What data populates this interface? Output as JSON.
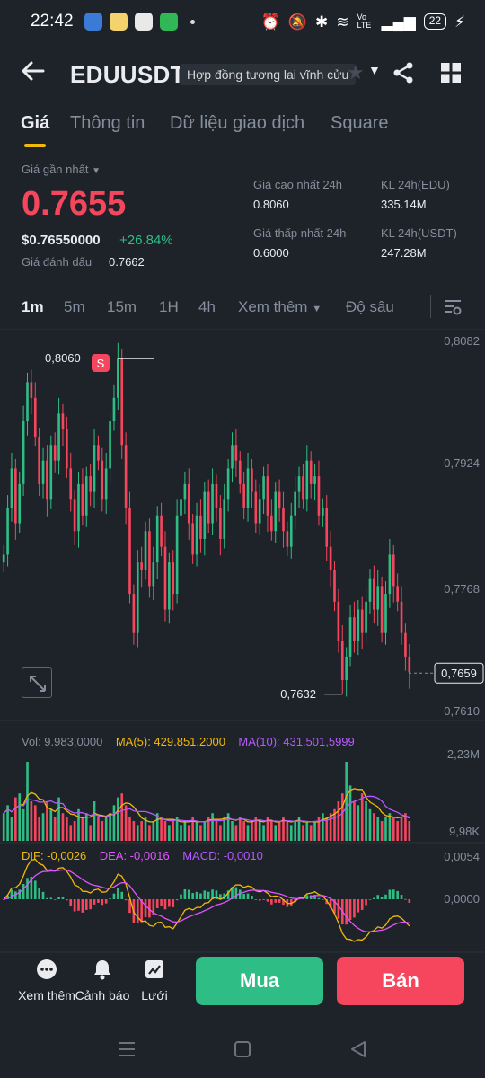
{
  "status_bar": {
    "time": "22:42",
    "battery": "22",
    "net": "Vo LTE",
    "icons": [
      "alarm-icon",
      "mute-icon",
      "bluetooth-icon",
      "wifi-icon",
      "signal-icon",
      "charging-icon"
    ]
  },
  "header": {
    "pair": "EDUUSDT",
    "contract_type": "Hợp đồng tương lai vĩnh cửu",
    "icons": [
      "back-arrow-icon",
      "star-icon",
      "share-icon",
      "grid-icon"
    ]
  },
  "tabs": [
    {
      "label": "Giá",
      "active": true
    },
    {
      "label": "Thông tin",
      "active": false
    },
    {
      "label": "Dữ liệu giao dịch",
      "active": false
    },
    {
      "label": "Square",
      "active": false
    }
  ],
  "ticker": {
    "last_price_label": "Giá gần nhất",
    "last_price": "0.7655",
    "usd_price": "$0.76550000",
    "change": "+26.84%",
    "mark_price_label": "Giá đánh dấu",
    "mark_price": "0.7662",
    "high_label": "Giá cao nhất 24h",
    "high": "0.8060",
    "low_label": "Giá thấp nhất 24h",
    "low": "0.6000",
    "vol_base_label": "KL 24h(EDU)",
    "vol_base": "335.14M",
    "vol_quote_label": "KL 24h(USDT)",
    "vol_quote": "247.28M"
  },
  "intervals": {
    "items": [
      {
        "label": "1m",
        "active": true
      },
      {
        "label": "5m",
        "active": false
      },
      {
        "label": "15m",
        "active": false
      },
      {
        "label": "1H",
        "active": false
      },
      {
        "label": "4h",
        "active": false
      }
    ],
    "more": "Xem thêm",
    "depth": "Độ sâu"
  },
  "chart_data": {
    "type": "candlestick",
    "price_axis_labels": [
      "0,8082",
      "0,7924",
      "0,7768",
      "0,7610"
    ],
    "price_axis_values": [
      0.8082,
      0.7924,
      0.7768,
      0.761
    ],
    "max_marker": "0,8060",
    "min_marker": "0,7632",
    "current_price": "0,7659",
    "current_price_value": 0.7659,
    "signal_badge": "S",
    "close_series": [
      0.781,
      0.787,
      0.792,
      0.785,
      0.79,
      0.798,
      0.803,
      0.801,
      0.796,
      0.79,
      0.793,
      0.788,
      0.795,
      0.793,
      0.799,
      0.797,
      0.792,
      0.788,
      0.784,
      0.79,
      0.786,
      0.791,
      0.789,
      0.795,
      0.793,
      0.788,
      0.792,
      0.798,
      0.801,
      0.806,
      0.795,
      0.787,
      0.776,
      0.771,
      0.78,
      0.779,
      0.784,
      0.777,
      0.78,
      0.786,
      0.782,
      0.774,
      0.78,
      0.776,
      0.786,
      0.788,
      0.79,
      0.785,
      0.781,
      0.786,
      0.783,
      0.789,
      0.785,
      0.79,
      0.787,
      0.783,
      0.788,
      0.792,
      0.795,
      0.793,
      0.79,
      0.787,
      0.792,
      0.789,
      0.785,
      0.788,
      0.791,
      0.786,
      0.784,
      0.789,
      0.787,
      0.784,
      0.782,
      0.786,
      0.789,
      0.791,
      0.788,
      0.793,
      0.79,
      0.791,
      0.786,
      0.787,
      0.782,
      0.779,
      0.775,
      0.77,
      0.765,
      0.768,
      0.773,
      0.77,
      0.774,
      0.771,
      0.775,
      0.778,
      0.774,
      0.777,
      0.771,
      0.776,
      0.781,
      0.777,
      0.775,
      0.771,
      0.768,
      0.766
    ],
    "volume": {
      "vol_label": "Vol: 9.983,0000",
      "ma5_label": "MA(5): 429.851,2000",
      "ma10_label": "MA(10): 431.501,5999",
      "axis_top": "2,23M",
      "axis_bottom": "9,98K",
      "values": [
        0.35,
        0.45,
        0.3,
        0.55,
        0.6,
        0.4,
        1.0,
        0.5,
        0.45,
        0.3,
        0.35,
        0.5,
        0.4,
        0.3,
        0.55,
        0.35,
        0.3,
        0.2,
        0.25,
        0.4,
        0.3,
        0.35,
        0.2,
        0.5,
        0.3,
        0.25,
        0.3,
        0.35,
        0.45,
        0.55,
        0.6,
        0.45,
        0.3,
        0.25,
        0.2,
        0.25,
        0.3,
        0.2,
        0.25,
        0.35,
        0.3,
        0.25,
        0.2,
        0.25,
        0.3,
        0.2,
        0.25,
        0.2,
        0.3,
        0.25,
        0.2,
        0.25,
        0.3,
        0.35,
        0.25,
        0.2,
        0.3,
        0.35,
        0.25,
        0.2,
        0.3,
        0.25,
        0.2,
        0.25,
        0.3,
        0.25,
        0.2,
        0.3,
        0.25,
        0.2,
        0.25,
        0.3,
        0.25,
        0.2,
        0.25,
        0.3,
        0.2,
        0.25,
        0.2,
        0.25,
        0.3,
        0.35,
        0.3,
        0.35,
        0.4,
        0.5,
        0.6,
        1.0,
        0.7,
        0.5,
        0.45,
        0.6,
        0.5,
        0.4,
        0.35,
        0.3,
        0.25,
        0.3,
        0.35,
        0.3,
        0.25,
        0.3,
        0.35,
        0.25
      ]
    },
    "macd": {
      "dif_label": "DIF: -0,0026",
      "dea_label": "DEA: -0,0016",
      "macd_label": "MACD: -0,0010",
      "axis_top": "0,0054",
      "axis_mid": "0,0000"
    }
  },
  "bottom_bar": {
    "more": "Xem thêm",
    "alert": "Cảnh báo",
    "grid": "Lưới",
    "buy": "Mua",
    "sell": "Bán"
  },
  "colors": {
    "background": "#1e2329",
    "up": "#2ebd85",
    "down": "#f6465d",
    "accent": "#f0b90b",
    "ma5": "#f0b90b",
    "ma10": "#b659ff"
  }
}
